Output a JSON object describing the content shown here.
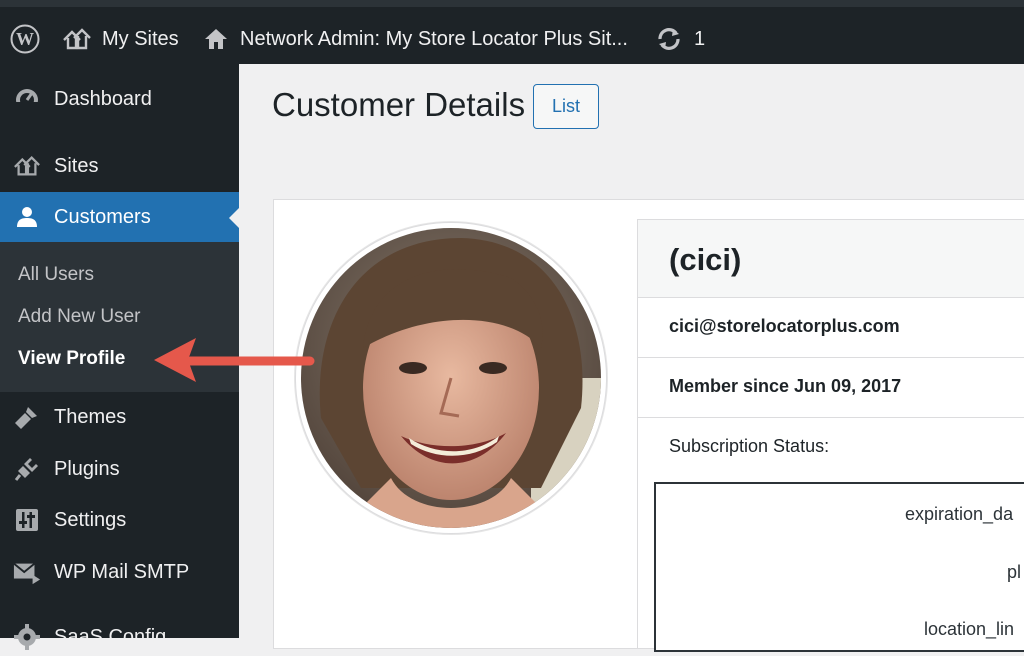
{
  "adminbar": {
    "wp_logo_icon": "wordpress-logo-icon",
    "my_sites_label": "My Sites",
    "network_admin_label": "Network Admin: My Store Locator Plus Sit...",
    "updates_count": "1"
  },
  "sidebar": {
    "items": [
      {
        "label": "Dashboard",
        "icon": "dashboard-icon"
      },
      {
        "label": "Sites",
        "icon": "sites-icon"
      },
      {
        "label": "Customers",
        "icon": "user-icon"
      },
      {
        "label": "Themes",
        "icon": "brush-icon"
      },
      {
        "label": "Plugins",
        "icon": "plugin-icon"
      },
      {
        "label": "Settings",
        "icon": "settings-icon"
      },
      {
        "label": "WP Mail SMTP",
        "icon": "mail-icon"
      },
      {
        "label": "SaaS Config",
        "icon": "gear-icon"
      }
    ],
    "submenu": [
      "All Users",
      "Add New User",
      "View Profile"
    ],
    "current_item": "Customers",
    "current_subitem": "View Profile"
  },
  "main": {
    "title": "Customer Details",
    "list_button": "List"
  },
  "customer": {
    "name": "(cici)",
    "email": "cici@storelocatorplus.com",
    "member_since": "Member since Jun 09, 2017",
    "subscription_status_label": "Subscription Status:",
    "subscription_keys": [
      "expiration_da",
      "pl",
      "location_lin"
    ]
  },
  "colors": {
    "adminbar_bg": "#1d2327",
    "accent": "#2271b1",
    "arrow": "#e5584b"
  }
}
